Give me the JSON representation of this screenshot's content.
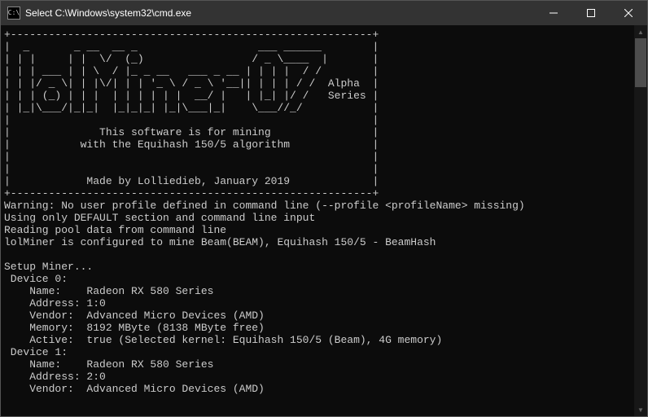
{
  "window": {
    "title": "Select C:\\Windows\\system32\\cmd.exe",
    "icon_glyph": "C:\\"
  },
  "banner": {
    "ascii": "+---------------------------------------------------------+\n|  _       _ __  __ _                   ___ ______        |\n| | |     | |  \\/  (_)                 / _ \\____  |       |\n| | | ___ | | \\  / |_ _ __   ___ _ __ | | | |  / /        |\n| | |/ _ \\| | |\\/| | | '_ \\ / _ \\ '__|| | | | / /  Alpha  |\n| | | (_) | | |  | | | | | |  __/ |   | |_| |/ /   Series |\n| |_|\\___/|_|_|  |_|_|_| |_|\\___|_|    \\___//_/           |\n|                                                         |\n|              This software is for mining                |\n|           with the Equihash 150/5 algorithm             |\n|                                                         |\n|                                                         |\n|            Made by Lolliedieb, January 2019             |\n+---------------------------------------------------------+"
  },
  "messages": {
    "warn_profile": "Warning: No user profile defined in command line (--profile <profileName> missing)",
    "default_section": "Using only DEFAULT section and command line input",
    "reading_pool": "Reading pool data from command line",
    "configured": "lolMiner is configured to mine Beam(BEAM), Equihash 150/5 - BeamHash",
    "setup": "Setup Miner..."
  },
  "devices": [
    {
      "header": " Device 0:",
      "name": "    Name:    Radeon RX 580 Series",
      "address": "    Address: 1:0",
      "vendor": "    Vendor:  Advanced Micro Devices (AMD)",
      "memory": "    Memory:  8192 MByte (8138 MByte free)",
      "active": "    Active:  true (Selected kernel: Equihash 150/5 (Beam), 4G memory)"
    },
    {
      "header": " Device 1:",
      "name": "    Name:    Radeon RX 580 Series",
      "address": "    Address: 2:0",
      "vendor": "    Vendor:  Advanced Micro Devices (AMD)"
    }
  ]
}
